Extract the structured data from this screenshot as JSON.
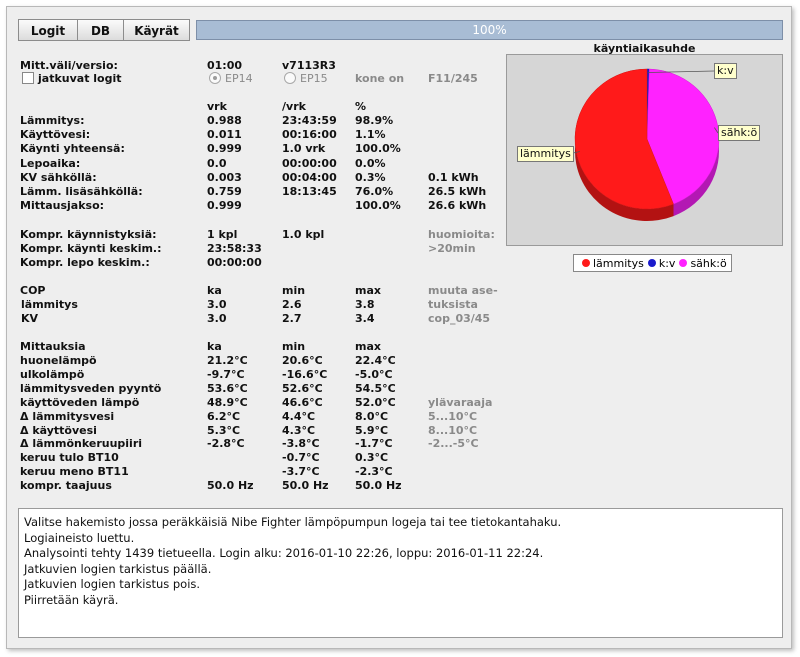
{
  "toolbar": {
    "logit": "Logit",
    "db": "DB",
    "kayrat": "Käyrät",
    "progress": "100%"
  },
  "info": {
    "mitt_label": "Mitt.väli/versio:",
    "interval": "01:00",
    "version": "v7113R3",
    "jatkuvat_label": "jatkuvat logit",
    "ep14": "EP14",
    "ep15": "EP15",
    "kone_on": "kone on",
    "model": "F11/245"
  },
  "runtime": {
    "headers": [
      "vrk",
      "/vrk",
      "%"
    ],
    "rows": [
      {
        "label": "Lämmitys:",
        "a": "0.988",
        "b": "23:43:59",
        "c": "98.9%",
        "d": ""
      },
      {
        "label": "Käyttövesi:",
        "a": "0.011",
        "b": "00:16:00",
        "c": "1.1%",
        "d": ""
      },
      {
        "label": "Käynti yhteensä:",
        "a": "0.999",
        "b": "1.0 vrk",
        "c": "100.0%",
        "d": ""
      },
      {
        "label": "Lepoaika:",
        "a": "0.0",
        "b": "00:00:00",
        "c": "0.0%",
        "d": ""
      },
      {
        "label": "KV sähköllä:",
        "a": "0.003",
        "b": "00:04:00",
        "c": "0.3%",
        "d": "0.1 kWh"
      },
      {
        "label": "Lämm. lisäsähköllä:",
        "a": "0.759",
        "b": "18:13:45",
        "c": "76.0%",
        "d": "26.5 kWh"
      },
      {
        "label": "Mittausjakso:",
        "a": "0.999",
        "b": "",
        "c": "100.0%",
        "d": "26.6 kWh"
      }
    ]
  },
  "compressor": {
    "starts_label": "Kompr. käynnistyksiä:",
    "starts_a": "1 kpl",
    "starts_b": "1.0 kpl",
    "note1": "huomioita:",
    "run_label": "Kompr. käynti keskim.:",
    "run_val": "23:58:33",
    "note2": ">20min",
    "rest_label": "Kompr. lepo keskim.:",
    "rest_val": "00:00:00"
  },
  "cop": {
    "title": "COP",
    "headers": [
      "ka",
      "min",
      "max"
    ],
    "rows": [
      {
        "label": "lämmitys",
        "ka": "3.0",
        "min": "2.6",
        "max": "3.8",
        "note": "tuksista"
      },
      {
        "label": "KV",
        "ka": "3.0",
        "min": "2.7",
        "max": "3.4",
        "note": "cop_03/45"
      }
    ],
    "note_top": "muuta ase-"
  },
  "measurements": {
    "title": "Mittauksia",
    "headers": [
      "ka",
      "min",
      "max"
    ],
    "rows": [
      {
        "label": "huonelämpö",
        "ka": "21.2°C",
        "min": "20.6°C",
        "max": "22.4°C",
        "note": ""
      },
      {
        "label": "ulkolämpö",
        "ka": "-9.7°C",
        "min": "-16.6°C",
        "max": "-5.0°C",
        "note": ""
      },
      {
        "label": "lämmitysveden pyyntö",
        "ka": "53.6°C",
        "min": "52.6°C",
        "max": "54.5°C",
        "note": ""
      },
      {
        "label": "käyttöveden lämpö",
        "ka": "48.9°C",
        "min": "46.6°C",
        "max": "52.0°C",
        "note": "ylävaraaja"
      },
      {
        "label": "Δ lämmitysvesi",
        "ka": "6.2°C",
        "min": "4.4°C",
        "max": "8.0°C",
        "note": "5...10°C"
      },
      {
        "label": "Δ käyttövesi",
        "ka": "5.3°C",
        "min": "4.3°C",
        "max": "5.9°C",
        "note": "8...10°C"
      },
      {
        "label": "Δ lämmönkeruupiiri",
        "ka": "-2.8°C",
        "min": "-3.8°C",
        "max": "-1.7°C",
        "note": "-2...-5°C"
      },
      {
        "label": "keruu tulo BT10",
        "ka": "",
        "min": "-0.7°C",
        "max": "0.3°C",
        "note": ""
      },
      {
        "label": "keruu meno BT11",
        "ka": "",
        "min": "-3.7°C",
        "max": "-2.3°C",
        "note": ""
      },
      {
        "label": "kompr. taajuus",
        "ka": "50.0 Hz",
        "min": "50.0 Hz",
        "max": "50.0 Hz",
        "note": ""
      }
    ]
  },
  "chart_data": {
    "type": "pie",
    "title": "käyntiaikasuhde",
    "categories": [
      "lämmitys",
      "k:v",
      "sähk:ö"
    ],
    "values": [
      56.0,
      0.5,
      43.5
    ],
    "colors": [
      "#ff1a1a",
      "#1a1acc",
      "#ff22ff"
    ],
    "legend_position": "bottom"
  },
  "log": {
    "lines": [
      "Valitse hakemisto jossa peräkkäisiä Nibe Fighter lämpöpumpun logeja tai tee tietokantahaku.",
      "Logiaineisto luettu.",
      "Analysointi tehty 1439 tietueella. Login alku: 2016-01-10 22:26, loppu: 2016-01-11 22:24.",
      "Jatkuvien logien tarkistus päällä.",
      "Jatkuvien logien tarkistus pois.",
      "Piirretään käyrä."
    ]
  }
}
